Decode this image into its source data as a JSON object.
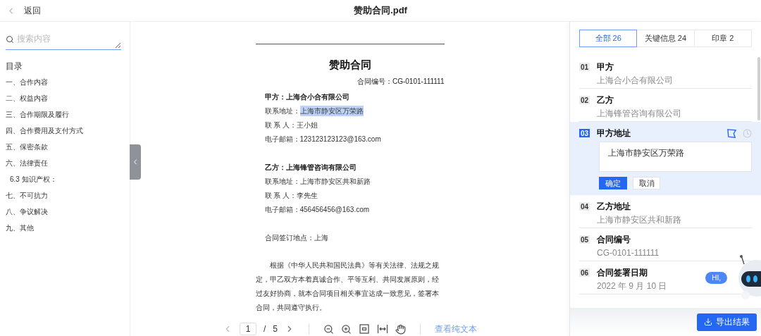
{
  "header": {
    "back_label": "返回",
    "title": "赞助合同.pdf"
  },
  "sidebar": {
    "search": {
      "placeholder": "搜索内容"
    },
    "toc_title": "目录",
    "toc": [
      {
        "label": "一、合作内容"
      },
      {
        "label": "二、权益内容"
      },
      {
        "label": "三、合作期限及履行"
      },
      {
        "label": "四、合作费用及支付方式"
      },
      {
        "label": "五、保密条款"
      },
      {
        "label": "六、法律责任",
        "children": [
          {
            "label": "6.3 知识产权："
          }
        ]
      },
      {
        "label": "七、不可抗力"
      },
      {
        "label": "八、争议解决"
      },
      {
        "label": "九、其他"
      }
    ]
  },
  "document": {
    "title": "赞助合同",
    "number": "合同编号：CG-0101-111111",
    "sections": [
      {
        "lines": [
          {
            "kind": "heading",
            "text": "甲方：上海合小合有限公司"
          },
          {
            "kind": "field",
            "label": "联系地址：",
            "value": "上海市静安区万荣路",
            "highlighted": true
          },
          {
            "kind": "field",
            "label": "联 系 人：",
            "value": "王小姐",
            "highlighted": false
          },
          {
            "kind": "field",
            "label": "电子邮箱：",
            "value": "123123123123@163.com",
            "highlighted": false
          }
        ]
      },
      {
        "lines": [
          {
            "kind": "heading",
            "text": "乙方：上海锋管咨询有限公司"
          },
          {
            "kind": "field",
            "label": "联系地址：",
            "value": "上海市静安区共和新路",
            "highlighted": false
          },
          {
            "kind": "field",
            "label": "联 系 人：",
            "value": "李先生",
            "highlighted": false
          },
          {
            "kind": "field",
            "label": "电子邮箱：",
            "value": "456456456@163.com",
            "highlighted": false
          }
        ]
      },
      {
        "lines": [
          {
            "kind": "text",
            "text": "合同签订地点：上海"
          }
        ]
      },
      {
        "lines": [
          {
            "kind": "paragraph",
            "text": "根据《中华人民共和国民法典》等有关法律、法规之规定，甲乙双方本着真诚合作、平等互利、共同发展原则，经过友好协商，就本合同项目相关事宜达成一致意见，签署本合同，共同遵守执行。"
          }
        ]
      }
    ]
  },
  "pager": {
    "page": "1",
    "separator": "/",
    "total": "5",
    "link": "查看纯文本"
  },
  "results": {
    "tabs": [
      {
        "label": "全部",
        "count": "26",
        "selected": true
      },
      {
        "label": "关键信息",
        "count": "24",
        "selected": false
      },
      {
        "label": "印章",
        "count": "2",
        "selected": false
      }
    ],
    "items": [
      {
        "number": "01",
        "title": "甲方",
        "value": "上海合小合有限公司",
        "selected": false
      },
      {
        "number": "02",
        "title": "乙方",
        "value": "上海锋管咨询有限公司",
        "selected": false
      },
      {
        "number": "03",
        "title": "甲方地址",
        "value": "上海市静安区万荣路",
        "selected": true
      },
      {
        "number": "04",
        "title": "乙方地址",
        "value": "上海市静安区共和新路",
        "selected": false
      },
      {
        "number": "05",
        "title": "合同编号",
        "value": "CG-0101-111111",
        "selected": false
      },
      {
        "number": "06",
        "title": "合同签署日期",
        "value": "2022 年 9 月 10 日",
        "selected": false
      }
    ],
    "editor": {
      "confirm": "确定",
      "cancel": "取消"
    },
    "export_label": "导出结果"
  },
  "assistant": {
    "greeting": "HI,"
  }
}
